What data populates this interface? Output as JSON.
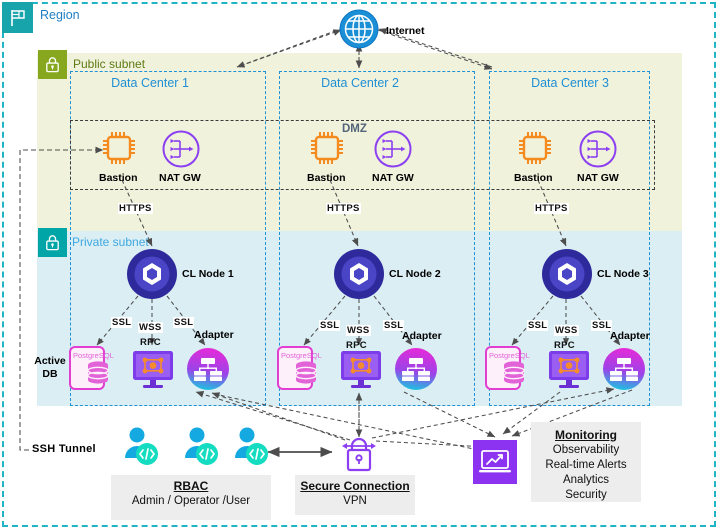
{
  "region": {
    "label": "Region",
    "icon": "flag-icon",
    "border_color": "#21b4c4"
  },
  "public_subnet": {
    "label": "Public subnet",
    "icon": "lock-icon",
    "bg": "#f0f2dc",
    "tag_color": "#87a81e"
  },
  "private_subnet": {
    "label": "Private subnet",
    "icon": "lock-icon",
    "bg": "#dbeef4",
    "tag_color": "#00a5a8"
  },
  "dmz": {
    "label": "DMZ"
  },
  "internet": {
    "label": "Internet",
    "icon": "globe-icon"
  },
  "data_centers": [
    {
      "title": "Data Center 1",
      "bastion": "Bastion",
      "nat_gw": "NAT GW",
      "https": "HTTPS",
      "node": "CL Node 1",
      "db": "PostgreSQL",
      "db_state": "Active\nDB",
      "rpc": "RPC",
      "adapter": "Adapter",
      "ssl_left": "SSL",
      "wss": "WSS",
      "ssl_right": "SSL"
    },
    {
      "title": "Data Center 2",
      "bastion": "Bastion",
      "nat_gw": "NAT GW",
      "https": "HTTPS",
      "node": "CL Node 2",
      "db": "PostgreSQL",
      "db_state": "",
      "rpc": "RPC",
      "adapter": "Adapter",
      "ssl_left": "SSL",
      "wss": "WSS",
      "ssl_right": "SSL"
    },
    {
      "title": "Data Center 3",
      "bastion": "Bastion",
      "nat_gw": "NAT GW",
      "https": "HTTPS",
      "node": "CL Node 3",
      "db": "PostgreSQL",
      "db_state": "",
      "rpc": "RPC",
      "adapter": "Adapter",
      "ssl_left": "SSL",
      "wss": "WSS",
      "ssl_right": "SSL"
    }
  ],
  "active_db": {
    "line1": "Active",
    "line2": "DB"
  },
  "ssh_tunnel": {
    "label": "SSH Tunnel"
  },
  "rbac": {
    "title": "RBAC",
    "subtitle": "Admin / Operator /User",
    "icon": "user-code-icon"
  },
  "vpn": {
    "title": "Secure Connection",
    "subtitle": "VPN",
    "icon": "padlock-icon"
  },
  "monitoring": {
    "title": "Monitoring",
    "icon": "analytics-monitor-icon",
    "lines": [
      "Observability",
      "Real-time Alerts",
      "Analytics",
      "Security"
    ]
  },
  "colors": {
    "teal": "#18a4ab",
    "olive": "#87a81e",
    "dc_blue": "#1f8fd4",
    "orange": "#f08a1e",
    "purple": "#7b3ff2",
    "node_blue": "#3d39b5",
    "magenta": "#e040c8",
    "cyan": "#19bcd4"
  }
}
